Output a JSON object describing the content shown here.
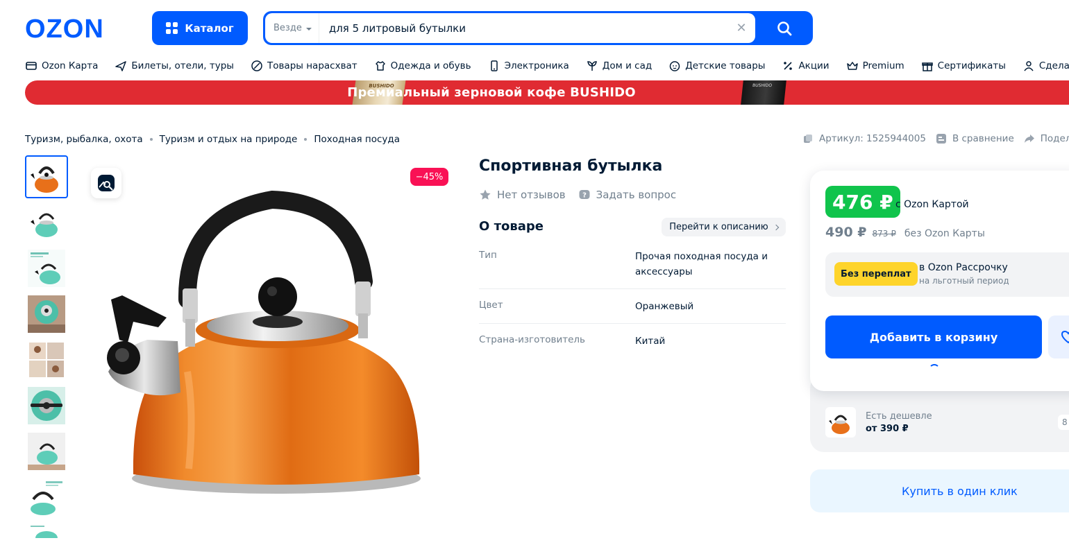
{
  "header": {
    "logo_text": "OZON",
    "catalog_label": "Каталог",
    "search": {
      "scope": "Везде",
      "value": "для 5 литровый бутылки",
      "clear_icon": "close-icon",
      "submit_icon": "search-icon"
    }
  },
  "nav": [
    {
      "label": "Ozon Карта",
      "icon": "card-icon"
    },
    {
      "label": "Билеты, отели, туры",
      "icon": "plane-icon"
    },
    {
      "label": "Товары нарасхват",
      "icon": "fire-icon"
    },
    {
      "label": "Одежда и обувь",
      "icon": "clothes-icon"
    },
    {
      "label": "Электроника",
      "icon": "phone-icon"
    },
    {
      "label": "Дом и сад",
      "icon": "plant-icon"
    },
    {
      "label": "Детские товары",
      "icon": "baby-icon"
    },
    {
      "label": "Акции",
      "icon": "percent-icon"
    },
    {
      "label": "Premium",
      "icon": "crown-icon"
    },
    {
      "label": "Сертификаты",
      "icon": "gift-icon"
    },
    {
      "label": "Сделано в Р",
      "icon": "person-icon"
    }
  ],
  "banner": {
    "text": "Премиальный зерновой кофе BUSHIDO",
    "pack_label": "BUSHIDO",
    "color": "#e02b32"
  },
  "breadcrumbs": [
    "Туризм, рыбалка, охота",
    "Туризм и отдых на природе",
    "Походная посуда"
  ],
  "meta": {
    "sku": "Артикул: 1525944005",
    "compare": "В сравнение",
    "share": "Подел"
  },
  "gallery": {
    "discount": "−45%",
    "thumbs_count": 9,
    "active_thumb": 0
  },
  "product": {
    "title": "Спортивная бутылка",
    "reviews": "Нет отзывов",
    "ask": "Задать вопрос",
    "about_title": "О товаре",
    "goto_description": "Перейти к описанию",
    "specs": [
      {
        "key": "Тип",
        "value": "Прочая походная посуда и аксессуары"
      },
      {
        "key": "Цвет",
        "value": "Оранжевый"
      },
      {
        "key": "Страна-изготовитель",
        "value": "Китай"
      }
    ]
  },
  "price": {
    "card_price": "476 ₽",
    "card_label": "с Ozon Картой",
    "regular_price": "490 ₽",
    "old_price": "873 ₽",
    "regular_label": "без Ozon Карты",
    "installment_badge": "Без переплат",
    "installment_title": "в Ozon Рассрочку",
    "installment_sub": "на льготный период",
    "add_to_cart": "Добавить в корзину",
    "cheaper_title": "Есть дешевле",
    "cheaper_price": "от 390 ₽",
    "cheaper_edge": "8",
    "one_click": "Купить в один клик"
  },
  "colors": {
    "brand_blue": "#005bff",
    "green_price": "#10c44c",
    "discount_pink": "#f91155",
    "yellow_badge": "#fed42b"
  }
}
